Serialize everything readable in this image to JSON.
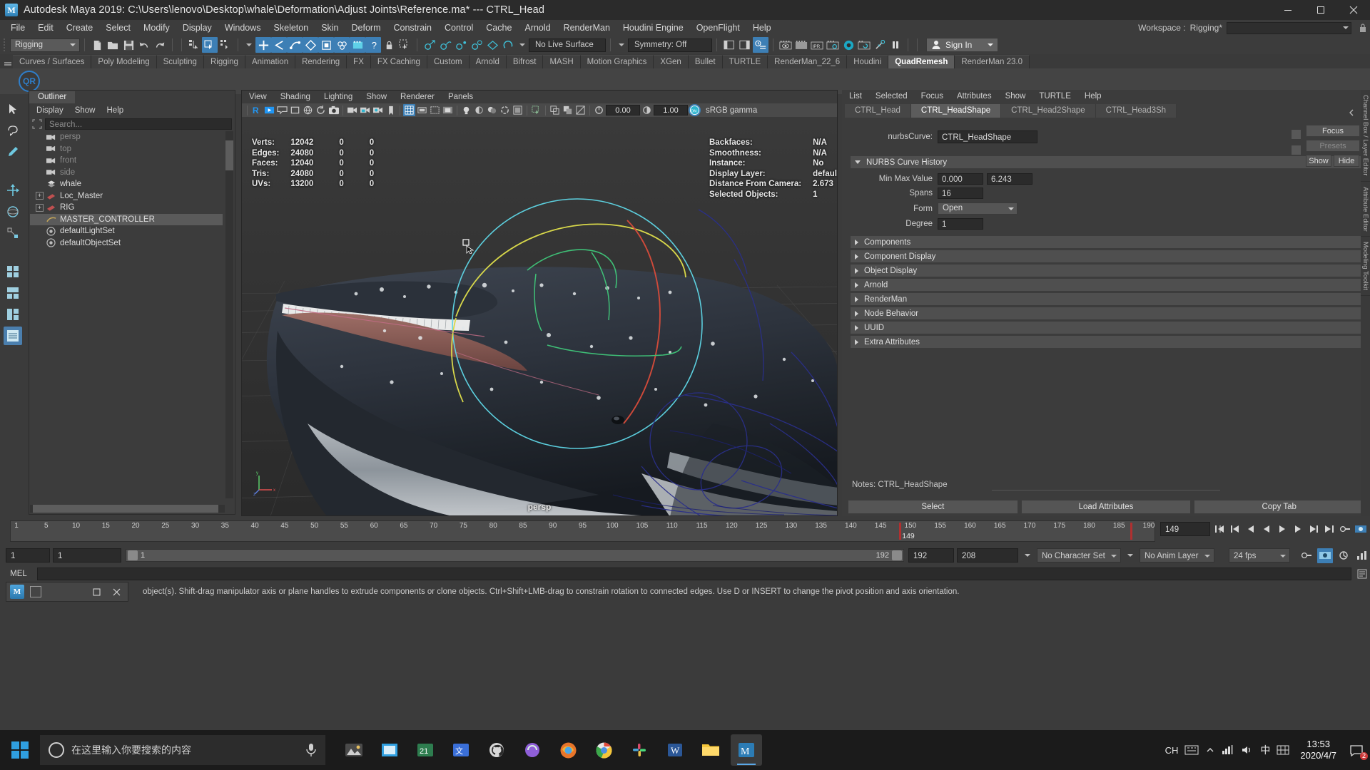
{
  "window": {
    "title": "Autodesk Maya 2019: C:\\Users\\lenovo\\Desktop\\whale\\Deformation\\Adjust Joints\\Reference.ma*   ---   CTRL_Head",
    "logo_text": "M",
    "minimize": "—",
    "maximize": "□",
    "close": "✕"
  },
  "menubar": {
    "items": [
      "File",
      "Edit",
      "Create",
      "Select",
      "Modify",
      "Display",
      "Windows",
      "Skeleton",
      "Skin",
      "Deform",
      "Constrain",
      "Control",
      "Cache",
      "Arnold",
      "RenderMan",
      "Houdini Engine",
      "OpenFlight",
      "Help"
    ],
    "workspace_label": "Workspace :",
    "workspace_value": "Rigging*"
  },
  "statusbar": {
    "menuset": "Rigging",
    "live_surface": "No Live Surface",
    "symmetry": "Symmetry: Off",
    "signin": "Sign In"
  },
  "shelf": {
    "tabs": [
      "Curves / Surfaces",
      "Poly Modeling",
      "Sculpting",
      "Rigging",
      "Animation",
      "Rendering",
      "FX",
      "FX Caching",
      "Custom",
      "Arnold",
      "Bifrost",
      "MASH",
      "Motion Graphics",
      "XGen",
      "Bullet",
      "TURTLE",
      "RenderMan_22_6",
      "Houdini",
      "QuadRemesh",
      "RenderMan 23.0"
    ],
    "active_tab": "QuadRemesh",
    "button_label": "QR"
  },
  "outliner": {
    "tab": "Outliner",
    "menus": [
      "Display",
      "Show",
      "Help"
    ],
    "search_placeholder": "Search...",
    "items": [
      {
        "label": "persp",
        "icon": "camera-icon",
        "indent": 1,
        "expandable": false,
        "selected": false,
        "dim": true
      },
      {
        "label": "top",
        "icon": "camera-icon",
        "indent": 1,
        "expandable": false,
        "selected": false,
        "dim": true
      },
      {
        "label": "front",
        "icon": "camera-icon",
        "indent": 1,
        "expandable": false,
        "selected": false,
        "dim": true
      },
      {
        "label": "side",
        "icon": "camera-icon",
        "indent": 1,
        "expandable": false,
        "selected": false,
        "dim": true
      },
      {
        "label": "whale",
        "icon": "mesh-icon",
        "indent": 1,
        "expandable": false,
        "selected": false,
        "dim": false
      },
      {
        "label": "Loc_Master",
        "icon": "transform-icon",
        "indent": 0,
        "expandable": true,
        "selected": false,
        "dim": false
      },
      {
        "label": "RIG",
        "icon": "transform-icon",
        "indent": 0,
        "expandable": true,
        "selected": false,
        "dim": false
      },
      {
        "label": "MASTER_CONTROLLER",
        "icon": "curve-icon",
        "indent": 1,
        "expandable": false,
        "selected": true,
        "dim": false
      },
      {
        "label": "defaultLightSet",
        "icon": "set-icon",
        "indent": 1,
        "expandable": false,
        "selected": false,
        "dim": false
      },
      {
        "label": "defaultObjectSet",
        "icon": "set-icon",
        "indent": 1,
        "expandable": false,
        "selected": false,
        "dim": false
      }
    ]
  },
  "viewport": {
    "menus": [
      "View",
      "Shading",
      "Lighting",
      "Show",
      "Renderer",
      "Panels"
    ],
    "exposure": "0.00",
    "gamma": "1.00",
    "color_space": "sRGB gamma",
    "camera_label": "persp",
    "hud_left": [
      {
        "key": "Verts:",
        "value": "12042",
        "c2": "0",
        "c3": "0"
      },
      {
        "key": "Edges:",
        "value": "24080",
        "c2": "0",
        "c3": "0"
      },
      {
        "key": "Faces:",
        "value": "12040",
        "c2": "0",
        "c3": "0"
      },
      {
        "key": "Tris:",
        "value": "24080",
        "c2": "0",
        "c3": "0"
      },
      {
        "key": "UVs:",
        "value": "13200",
        "c2": "0",
        "c3": "0"
      }
    ],
    "hud_right": [
      {
        "key": "Backfaces:",
        "value": "N/A"
      },
      {
        "key": "Smoothness:",
        "value": "N/A"
      },
      {
        "key": "Instance:",
        "value": "No"
      },
      {
        "key": "Display Layer:",
        "value": "default"
      },
      {
        "key": "Distance From Camera:",
        "value": "2.673"
      },
      {
        "key": "Selected Objects:",
        "value": "1"
      }
    ]
  },
  "attribute_editor": {
    "menus": [
      "List",
      "Selected",
      "Focus",
      "Attributes",
      "Show",
      "TURTLE",
      "Help"
    ],
    "tabs": [
      "CTRL_Head",
      "CTRL_HeadShape",
      "CTRL_Head2Shape",
      "CTRL_Head3Sh"
    ],
    "active_tab": "CTRL_HeadShape",
    "node_type_label": "nurbsCurve:",
    "node_name": "CTRL_HeadShape",
    "side_buttons": [
      "Focus",
      "Presets"
    ],
    "show_label": "Show",
    "hide_label": "Hide",
    "section_curve_history": "NURBS Curve History",
    "fields": [
      {
        "label": "Min Max Value",
        "v1": "0.000",
        "v2": "6.243"
      },
      {
        "label": "Spans",
        "v1": "16"
      },
      {
        "label": "Form",
        "v1": "Open"
      },
      {
        "label": "Degree",
        "v1": "1"
      }
    ],
    "sections": [
      "Components",
      "Component Display",
      "Object Display",
      "Arnold",
      "RenderMan",
      "Node Behavior",
      "UUID",
      "Extra Attributes"
    ],
    "notes_label": "Notes: CTRL_HeadShape",
    "footer_buttons": [
      "Select",
      "Load Attributes",
      "Copy Tab"
    ]
  },
  "right_strip": [
    "Channel Box / Layer Editor",
    "Attribute Editor",
    "Modeling Toolkit"
  ],
  "timeline": {
    "ticks": [
      "1",
      "5",
      "10",
      "15",
      "20",
      "25",
      "30",
      "35",
      "40",
      "45",
      "50",
      "55",
      "60",
      "65",
      "70",
      "75",
      "80",
      "85",
      "90",
      "95",
      "100",
      "105",
      "110",
      "115",
      "120",
      "125",
      "130",
      "135",
      "140",
      "145",
      "150",
      "155",
      "160",
      "165",
      "170",
      "175",
      "180",
      "185",
      "190"
    ],
    "current_frame": "149",
    "current_field": "149",
    "key_label": "149"
  },
  "range": {
    "start_field": "1",
    "anim_start": "1",
    "playback_start": "1",
    "playback_end": "192",
    "anim_end_a": "192",
    "anim_end_b": "208",
    "character_set": "No Character Set",
    "anim_layer": "No Anim Layer",
    "fps": "24 fps"
  },
  "command_line": {
    "label": "MEL",
    "value": ""
  },
  "helpline": {
    "text": "object(s). Shift-drag manipulator axis or plane handles to extrude components or clone objects. Ctrl+Shift+LMB-drag to constrain rotation to connected edges. Use D or INSERT to change the pivot position and axis orientation."
  },
  "taskbar": {
    "search_placeholder": "在这里输入你要搜索的内容",
    "ime": "CH",
    "time": "13:53",
    "date": "2020/4/7",
    "notification_count": "2"
  },
  "colors": {
    "accent_blue": "#3d7fb5",
    "panel_bg": "#3c3c3c",
    "title_bg": "#2b2b2b",
    "selected_row": "#5a5a5a",
    "cyan": "#2fb5cf",
    "playhead_red": "#b03030"
  }
}
